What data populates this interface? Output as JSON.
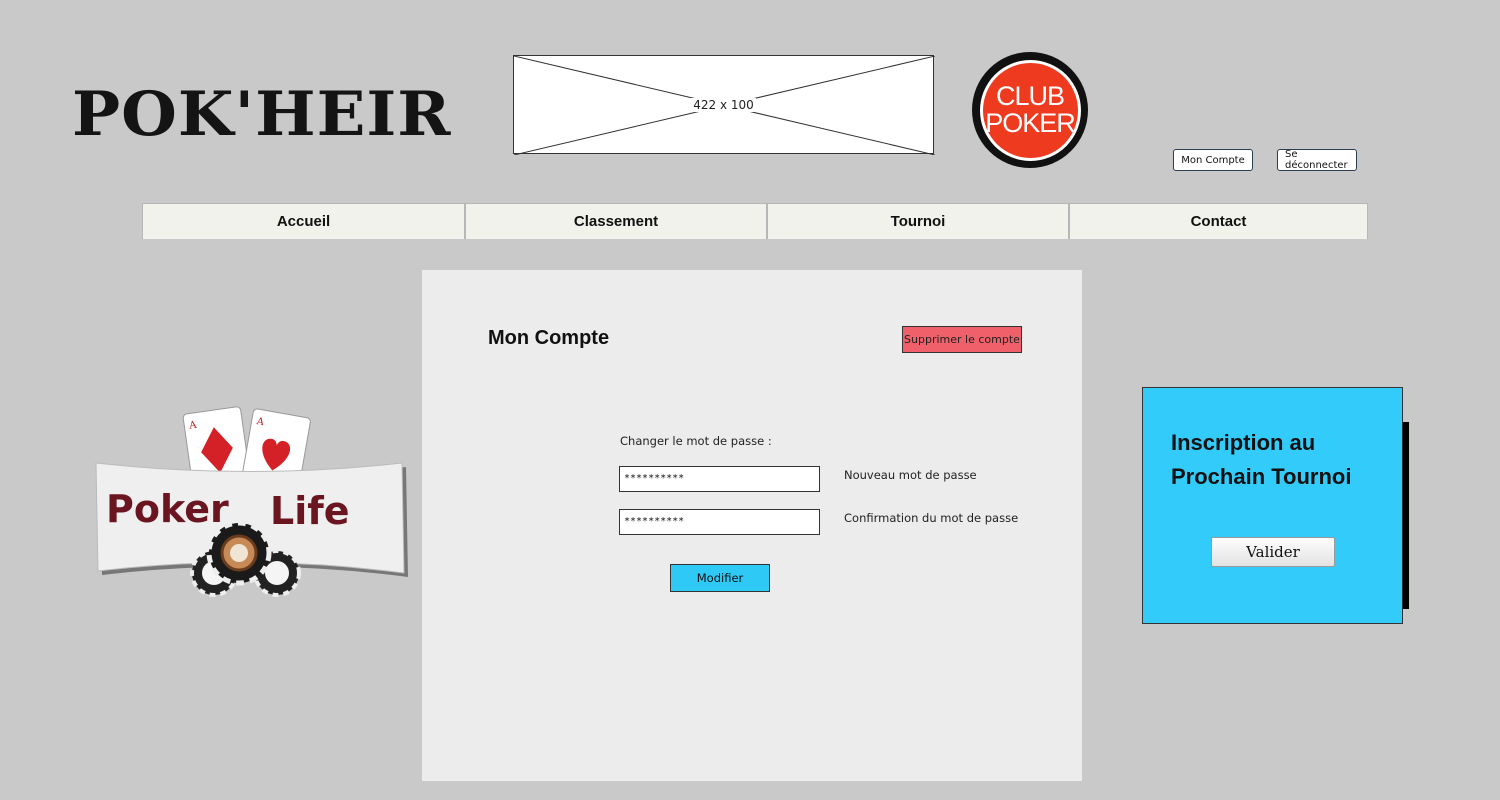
{
  "header": {
    "logo_text": "POK'HEIR",
    "banner_placeholder": "422 x 100",
    "club_logo": {
      "line1": "CLUB",
      "line2": "POKER"
    },
    "account_button": "Mon Compte",
    "logout_button": "Se déconnecter"
  },
  "nav": {
    "items": [
      {
        "label": "Accueil"
      },
      {
        "label": "Classement"
      },
      {
        "label": "Tournoi"
      },
      {
        "label": "Contact"
      }
    ]
  },
  "main": {
    "title": "Mon Compte",
    "delete_button": "Supprimer le compte",
    "change_password_label": "Changer le mot de passe :",
    "new_password_value": "**********",
    "new_password_label": "Nouveau mot de passe",
    "confirm_password_value": "**********",
    "confirm_password_label": "Confirmation du mot de passe",
    "modify_button": "Modifier"
  },
  "side_logo": {
    "word1": "Poker",
    "word2": "Life"
  },
  "tournament_card": {
    "title": "Inscription au Prochain Tournoi",
    "validate_button": "Valider"
  },
  "colors": {
    "background": "#c9c9c9",
    "accent_cyan": "#32cbfa",
    "danger_red": "#f0606a",
    "club_red": "#ee3b1f"
  },
  "icons": [
    "image-placeholder-icon",
    "club-poker-logo",
    "poker-life-logo"
  ]
}
